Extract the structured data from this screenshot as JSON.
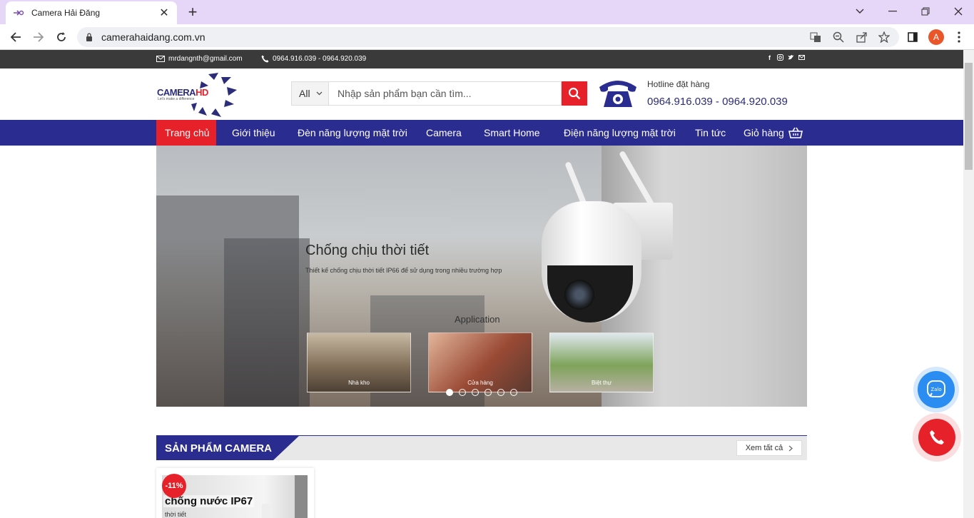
{
  "browser": {
    "tab_title": "Camera Hải Đăng",
    "url": "camerahaidang.com.vn",
    "profile_initial": "A",
    "icons": [
      "favicon-icon",
      "close-icon",
      "plus-icon",
      "chevron-down-icon",
      "minimize-icon",
      "restore-icon",
      "close-window-icon",
      "back-icon",
      "forward-icon",
      "reload-icon",
      "lock-icon",
      "translate-icon",
      "zoom-icon",
      "share-icon",
      "star-icon",
      "sidepanel-icon",
      "kebab-menu-icon"
    ]
  },
  "topbar": {
    "email": "mrdangnth@gmail.com",
    "phones": "0964.916.039 - 0964.920.039",
    "social": [
      "facebook-icon",
      "instagram-icon",
      "twitter-icon",
      "mail-icon"
    ]
  },
  "header": {
    "logo_text_main": "CAMERA",
    "logo_text_accent": "HD",
    "logo_tagline": "Let's make a difference",
    "search": {
      "category": "All",
      "placeholder": "Nhập sản phẩm bạn cần tìm..."
    },
    "hotline_label": "Hotline đặt hàng",
    "hotline_number": "0964.916.039 - 0964.920.039"
  },
  "nav": {
    "items": [
      {
        "label": "Trang chủ",
        "active": true
      },
      {
        "label": "Giới thiệu"
      },
      {
        "label": "Đèn năng lượng mặt trời"
      },
      {
        "label": "Camera"
      },
      {
        "label": "Smart Home"
      },
      {
        "label": "Điện năng lượng mặt trời"
      },
      {
        "label": "Tin tức"
      },
      {
        "label": "Giỏ hàng"
      }
    ]
  },
  "banner": {
    "title": "Chống chịu thời tiết",
    "subtitle": "Thiết kế chống chịu thời tiết IP66 để sử dụng trong nhiều trường hợp",
    "application_label": "Application",
    "thumbs": [
      "Nhà kho",
      "Cửa hàng",
      "Biệt thự"
    ],
    "slide_count": 6,
    "active_slide": 1
  },
  "section": {
    "title": "SẢN PHẨM CAMERA",
    "view_all": "Xem tất cả"
  },
  "product": {
    "sale_badge": "-11%",
    "image_title": "chống nước IP67",
    "image_sub": "thời tiết"
  },
  "colors": {
    "brand_blue": "#2b2c8f",
    "brand_red": "#e62129",
    "tab_strip": "#e6d6f7",
    "zalo_blue": "#2b8cf2"
  }
}
